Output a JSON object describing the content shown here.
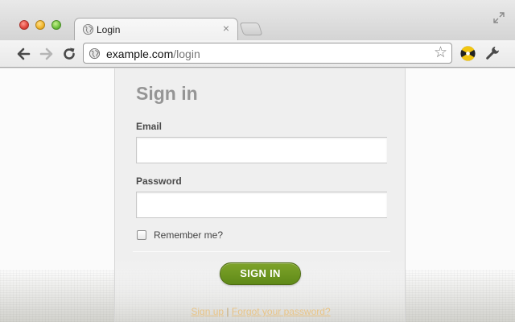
{
  "browser": {
    "tab": {
      "title": "Login",
      "close_glyph": "×",
      "icon": "globe-icon"
    },
    "url": {
      "host": "example.com",
      "path": "/login"
    },
    "icons": {
      "back": "back-arrow-icon",
      "forward": "forward-arrow-icon",
      "reload": "reload-icon",
      "bookmark": "star-icon",
      "extension": "extension-icon",
      "settings": "wrench-icon",
      "fullscreen": "fullscreen-icon"
    },
    "star_glyph": "☆"
  },
  "login": {
    "title": "Sign in",
    "email_label": "Email",
    "email_value": "",
    "password_label": "Password",
    "password_value": "",
    "remember_label": "Remember me?",
    "remember_checked": false,
    "submit_label": "SIGN IN",
    "signup_link": "Sign up",
    "separator": "|",
    "forgot_link": "Forgot your password?"
  },
  "colors": {
    "button_green": "#6a941e",
    "link_color": "#e8c487",
    "title_gray": "#959595"
  }
}
